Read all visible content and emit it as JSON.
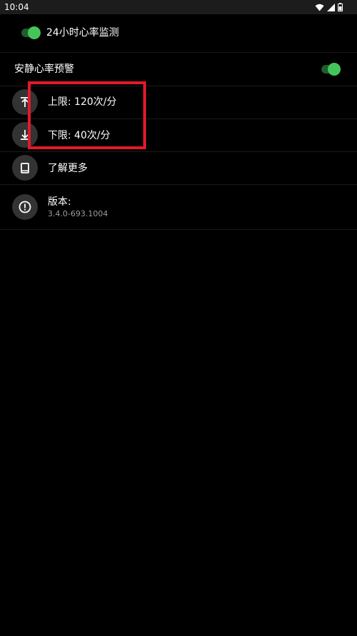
{
  "status_bar": {
    "time": "10:04"
  },
  "monitoring": {
    "label": "24小时心率监测",
    "enabled": true
  },
  "resting_alert": {
    "label": "安静心率预警",
    "enabled": true
  },
  "upper_limit": {
    "label": "上限: 120次/分",
    "icon": "upper-limit-icon"
  },
  "lower_limit": {
    "label": "下限: 40次/分",
    "icon": "lower-limit-icon"
  },
  "learn_more": {
    "label": "了解更多",
    "icon": "book-icon"
  },
  "version": {
    "label": "版本:",
    "value": "3.4.0-693.1004",
    "icon": "info-icon"
  },
  "colors": {
    "background": "#000000",
    "toggle_on": "#45c558",
    "highlight": "#e3182a",
    "icon_bg": "#333333",
    "secondary_text": "#9a9a9a"
  }
}
